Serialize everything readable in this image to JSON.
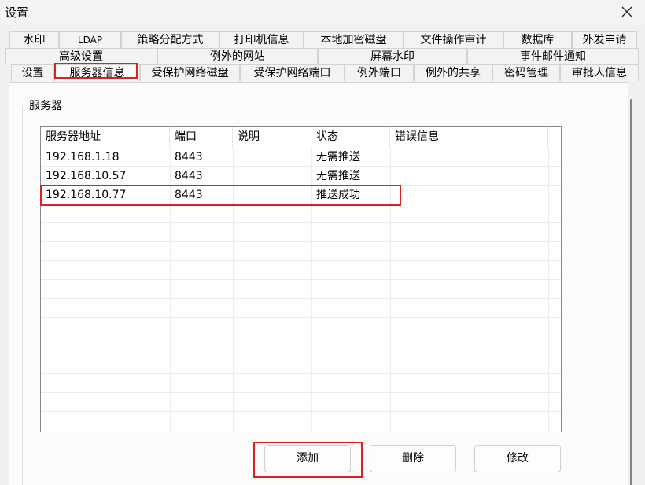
{
  "window": {
    "title": "设置"
  },
  "tabs": {
    "row1": [
      "水印",
      "LDAP",
      "策略分配方式",
      "打印机信息",
      "本地加密磁盘",
      "文件操作审计",
      "数据库",
      "外发申请"
    ],
    "row2": [
      "高级设置",
      "例外的网站",
      "屏幕水印",
      "事件邮件通知"
    ],
    "row3": [
      "设置",
      "服务器信息",
      "受保护网络磁盘",
      "受保护网络端口",
      "例外端口",
      "例外的共享",
      "密码管理",
      "审批人信息"
    ],
    "active": "服务器信息"
  },
  "server_group": {
    "label": "服务器",
    "columns": [
      "服务器地址",
      "端口",
      "说明",
      "状态",
      "错误信息"
    ],
    "rows": [
      [
        "192.168.1.18",
        "8443",
        "",
        "无需推送",
        ""
      ],
      [
        "192.168.10.57",
        "8443",
        "",
        "无需推送",
        ""
      ],
      [
        "192.168.10.77",
        "8443",
        "",
        "推送成功",
        ""
      ]
    ]
  },
  "buttons": {
    "add": "添加",
    "delete": "删除",
    "modify": "修改"
  },
  "colors": {
    "highlight": "#e02020"
  }
}
